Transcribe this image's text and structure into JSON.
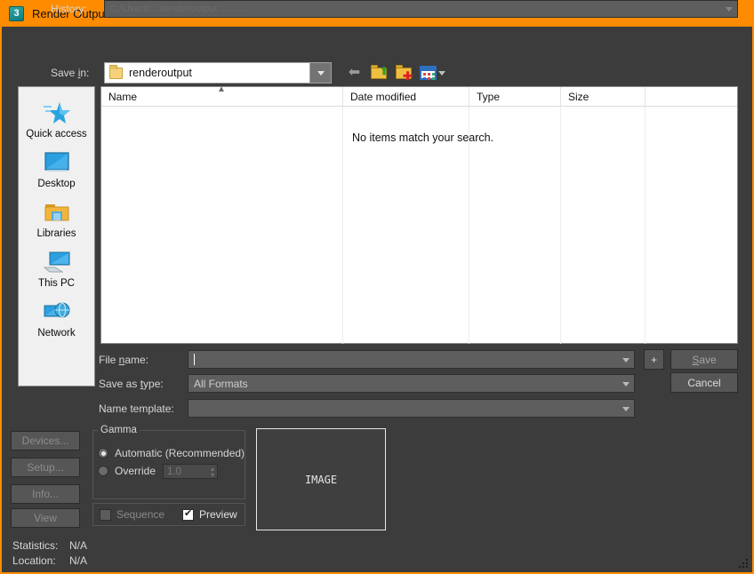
{
  "titlebar": {
    "icon": "3dsmax-icon",
    "icon_glyph": "3",
    "title": "Render Output File",
    "close_label": "✕"
  },
  "history": {
    "label": "History:",
    "value": "C:\\Users\\...\\renderoutput   ...   ...   ...",
    "placeholder": ""
  },
  "savein": {
    "label": "Save in:",
    "value": "renderoutput",
    "folder_icon": "folder-icon",
    "dropdown_icon": "chevron-down-icon"
  },
  "toolbar": {
    "back": "back-arrow-icon",
    "up": "up-one-level-icon",
    "new_folder": "new-folder-icon",
    "views": "views-icon",
    "views_dropdown": "chevron-down-icon"
  },
  "places": {
    "items": [
      {
        "label": "Quick access",
        "icon": "star-icon"
      },
      {
        "label": "Desktop",
        "icon": "monitor-icon"
      },
      {
        "label": "Libraries",
        "icon": "libraries-folder-icon"
      },
      {
        "label": "This PC",
        "icon": "computer-icon"
      },
      {
        "label": "Network",
        "icon": "network-globe-icon"
      }
    ]
  },
  "filelist": {
    "columns": [
      "Name",
      "Date modified",
      "Type",
      "Size",
      ""
    ],
    "sort_marker": "▲",
    "empty_message": "No items match your search.",
    "rows": []
  },
  "form": {
    "filename_label": "File name:",
    "filename_label_pre": "File ",
    "filename_label_accel": "n",
    "filename_label_post": "ame:",
    "filename_value": "",
    "savetype_label_pre": "Save as ",
    "savetype_label_accel": "t",
    "savetype_label_post": "ype:",
    "savetype_value": "All Formats",
    "template_label": "Name template:",
    "template_value": ""
  },
  "buttons": {
    "plus": "+",
    "save_accel": "S",
    "save_post": "ave",
    "cancel": "Cancel",
    "devices": "Devices...",
    "setup": "Setup...",
    "info": "Info...",
    "view": "View"
  },
  "gamma": {
    "title": "Gamma",
    "automatic_label": "Automatic (Recommended)",
    "automatic_selected": true,
    "override_label": "Override",
    "override_selected": false,
    "override_value": "1.0",
    "spinner_up": "▴",
    "spinner_down": "▾"
  },
  "options": {
    "sequence_label": "Sequence",
    "sequence_checked": false,
    "preview_label": "Preview",
    "preview_checked": true
  },
  "preview": {
    "placeholder_text": "IMAGE"
  },
  "status": {
    "statistics_label": "Statistics:",
    "statistics_value": "N/A",
    "location_label": "Location:",
    "location_value": "N/A"
  },
  "colors": {
    "titlebar": "#ff8c00",
    "dialog_bg": "#3c3c3c",
    "field_bg": "#5e5e5e",
    "list_bg": "#ffffff",
    "text": "#d6d6d6"
  }
}
